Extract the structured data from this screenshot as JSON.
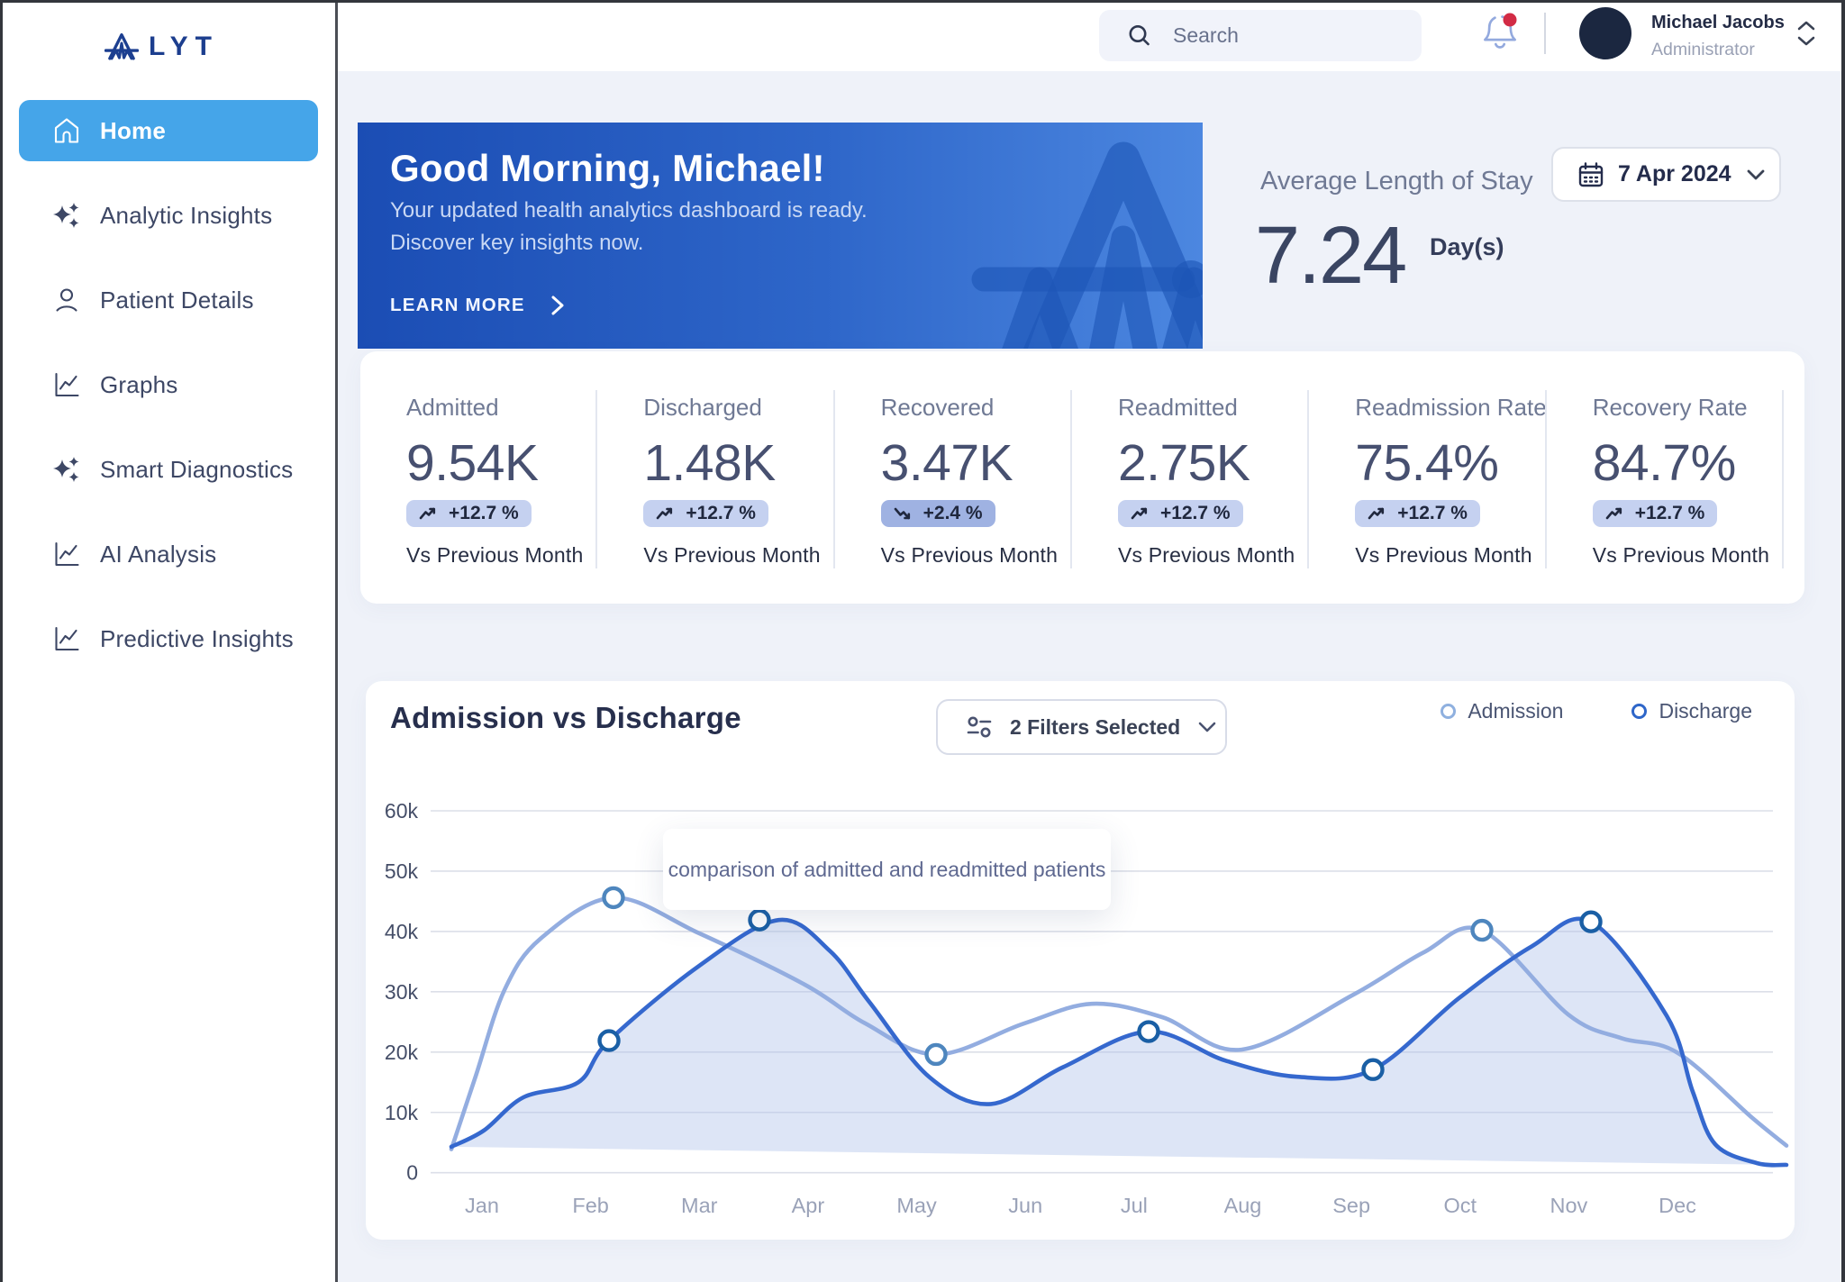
{
  "colors": {
    "accent_blue": "#45a5e9",
    "brand_navy": "#1c3f90",
    "banner_gradient_start": "#1b4db4",
    "banner_gradient_end": "#4c87e0",
    "badge_bg": "#c5d1f0",
    "badge_bg_down": "#9fb2e2",
    "admission_line": "#93ade0",
    "discharge_line": "#3568ce",
    "notification_dot": "#d22b45"
  },
  "sidebar": {
    "logo_text": "LYT",
    "items": [
      {
        "label": "Home",
        "icon": "home-icon",
        "active": true
      },
      {
        "label": "Analytic Insights",
        "icon": "sparkles-icon",
        "active": false
      },
      {
        "label": "Patient Details",
        "icon": "user-icon",
        "active": false
      },
      {
        "label": "Graphs",
        "icon": "chart-icon",
        "active": false
      },
      {
        "label": "Smart Diagnostics",
        "icon": "sparkles-icon",
        "active": false
      },
      {
        "label": "AI Analysis",
        "icon": "chart-icon",
        "active": false
      },
      {
        "label": "Predictive Insights",
        "icon": "chart-icon",
        "active": false
      }
    ]
  },
  "topbar": {
    "search_placeholder": "Search",
    "has_notification": true,
    "user": {
      "name": "Michael Jacobs",
      "role": "Administrator"
    }
  },
  "hero": {
    "title": "Good Morning, Michael!",
    "subtitle_line1": "Your updated health analytics dashboard is ready.",
    "subtitle_line2": "Discover key insights now.",
    "cta_label": "LEARN MORE"
  },
  "stay": {
    "label": "Average Length of Stay",
    "value": "7.24",
    "unit": "Day(s)",
    "date": "7 Apr 2024"
  },
  "stats": [
    {
      "label": "Admitted",
      "value": "9.54K",
      "delta": "+12.7 %",
      "direction": "up",
      "vs": "Vs Previous Month"
    },
    {
      "label": "Discharged",
      "value": "1.48K",
      "delta": "+12.7 %",
      "direction": "up",
      "vs": "Vs Previous Month"
    },
    {
      "label": "Recovered",
      "value": "3.47K",
      "delta": "+2.4 %",
      "direction": "down",
      "vs": "Vs Previous Month"
    },
    {
      "label": "Readmitted",
      "value": "2.75K",
      "delta": "+12.7 %",
      "direction": "up",
      "vs": "Vs Previous Month"
    },
    {
      "label": "Readmission Rate",
      "value": "75.4%",
      "delta": "+12.7 %",
      "direction": "up",
      "vs": "Vs Previous Month"
    },
    {
      "label": "Recovery Rate",
      "value": "84.7%",
      "delta": "+12.7 %",
      "direction": "up",
      "vs": "Vs Previous Month"
    }
  ],
  "chart": {
    "title": "Admission vs Discharge",
    "filters_label": "2 Filters Selected",
    "tooltip": "comparison of admitted and readmitted patients"
  },
  "chart_data": {
    "type": "line",
    "title": "Admission vs Discharge",
    "x": [
      "Jan",
      "Feb",
      "Mar",
      "Apr",
      "May",
      "Jun",
      "Jul",
      "Aug",
      "Sep",
      "Oct",
      "Nov",
      "Dec"
    ],
    "ylim": [
      0,
      60000
    ],
    "yticks": [
      "0",
      "10k",
      "20k",
      "30k",
      "40k",
      "50k",
      "60k"
    ],
    "grid": true,
    "legend_position": "top-right",
    "series": [
      {
        "name": "Admission",
        "color": "#93ade0",
        "area": false,
        "values": [
          13500,
          44800,
          39700,
          31200,
          20300,
          24700,
          27500,
          20500,
          29500,
          39500,
          26100,
          19900
        ]
      },
      {
        "name": "Discharge",
        "color": "#3568ce",
        "area": true,
        "values": [
          7000,
          16000,
          34300,
          40000,
          15800,
          11300,
          23300,
          17500,
          16500,
          28900,
          40900,
          16000
        ]
      }
    ],
    "spline": {
      "Admission": [
        [
          -0.282,
          3.9
        ],
        [
          -0.058,
          16
        ],
        [
          0.207,
          30.3
        ],
        [
          0.539,
          38.8
        ],
        [
          1.21,
          45.6
        ],
        [
          1.998,
          39.7
        ],
        [
          2.968,
          31.2
        ],
        [
          3.523,
          24.8
        ],
        [
          4.178,
          19.6
        ],
        [
          4.982,
          24.7
        ],
        [
          5.612,
          28.0
        ],
        [
          6.258,
          25.8
        ],
        [
          6.988,
          20.4
        ],
        [
          8.016,
          29.5
        ],
        [
          8.662,
          36.5
        ],
        [
          9.201,
          40.2
        ],
        [
          9.997,
          26.2
        ],
        [
          10.486,
          22.3
        ],
        [
          11.0,
          19.9
        ],
        [
          11.688,
          9.1
        ],
        [
          12.003,
          4.5
        ]
      ],
      "Discharge": [
        [
          -0.282,
          4.3
        ],
        [
          0.017,
          7
        ],
        [
          0.381,
          12.5
        ],
        [
          0.887,
          15
        ],
        [
          1.169,
          21.9
        ],
        [
          1.998,
          34.3
        ],
        [
          2.73,
          41.9
        ],
        [
          3.2,
          36.8
        ],
        [
          3.564,
          28.3
        ],
        [
          4.12,
          15.8
        ],
        [
          4.684,
          11.4
        ],
        [
          5.347,
          17.5
        ],
        [
          6.134,
          23.4
        ],
        [
          6.839,
          18.6
        ],
        [
          7.502,
          15.9
        ],
        [
          8.198,
          17.1
        ],
        [
          8.986,
          28.9
        ],
        [
          9.657,
          37.5
        ],
        [
          10.204,
          41.6
        ],
        [
          10.901,
          26
        ],
        [
          11.141,
          13.4
        ],
        [
          11.348,
          4.7
        ],
        [
          11.73,
          1.6
        ],
        [
          12.003,
          1.3
        ]
      ]
    },
    "markers": [
      {
        "series": "Admission",
        "m": 1.21,
        "v": 45.6
      },
      {
        "series": "Admission",
        "m": 4.178,
        "v": 19.6
      },
      {
        "series": "Admission",
        "m": 9.201,
        "v": 40.2
      },
      {
        "series": "Discharge",
        "m": 1.169,
        "v": 21.9
      },
      {
        "series": "Discharge",
        "m": 2.553,
        "v": 41.9
      },
      {
        "series": "Discharge",
        "m": 6.134,
        "v": 23.4
      },
      {
        "series": "Discharge",
        "m": 8.198,
        "v": 17.1
      },
      {
        "series": "Discharge",
        "m": 10.204,
        "v": 41.6
      }
    ]
  }
}
